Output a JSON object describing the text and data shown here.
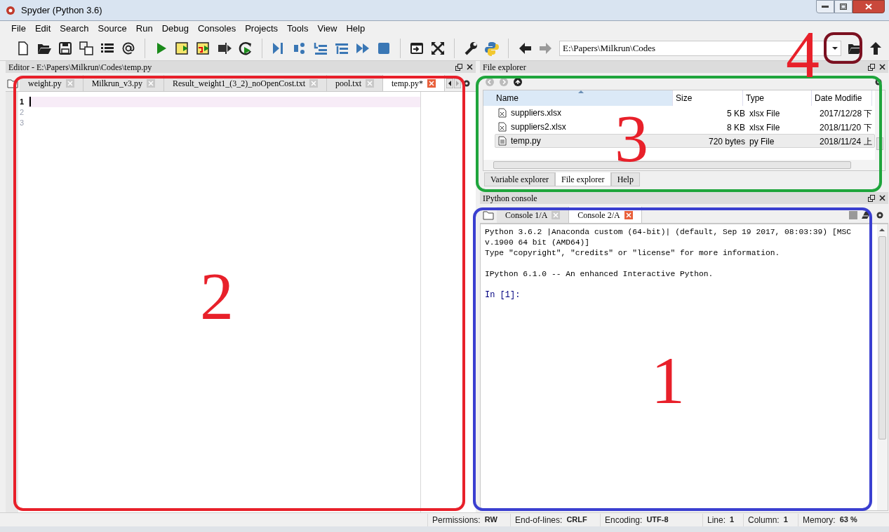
{
  "window": {
    "title": "Spyder (Python 3.6)"
  },
  "menu": [
    "File",
    "Edit",
    "Search",
    "Source",
    "Run",
    "Debug",
    "Consoles",
    "Projects",
    "Tools",
    "View",
    "Help"
  ],
  "toolbar": {
    "path": "E:\\Papers\\Milkrun\\Codes"
  },
  "editor": {
    "title": "Editor - E:\\Papers\\Milkrun\\Codes\\temp.py",
    "tabs": [
      {
        "label": "weight.py",
        "selected": false
      },
      {
        "label": "Milkrun_v3.py",
        "selected": false
      },
      {
        "label": "Result_weight1_(3_2)_noOpenCost.txt",
        "selected": false
      },
      {
        "label": "pool.txt",
        "selected": false
      },
      {
        "label": "temp.py*",
        "selected": true
      }
    ],
    "lines": [
      {
        "number": "1",
        "current": true
      },
      {
        "number": "2",
        "current": false
      },
      {
        "number": "3",
        "current": false
      }
    ]
  },
  "file_explorer": {
    "title": "File explorer",
    "columns": [
      "Name",
      "Size",
      "Type",
      "Date Modifie"
    ],
    "rows": [
      {
        "kind": "excel",
        "name": "suppliers.xlsx",
        "size": "5 KB",
        "type": "xlsx File",
        "date": "2017/12/28 下",
        "selected": false
      },
      {
        "kind": "excel",
        "name": "suppliers2.xlsx",
        "size": "8 KB",
        "type": "xlsx File",
        "date": "2018/11/20 下",
        "selected": false
      },
      {
        "kind": "text",
        "name": "temp.py",
        "size": "720 bytes",
        "type": "py File",
        "date": "2018/11/24 上",
        "selected": true
      }
    ],
    "tabs": [
      {
        "label": "Variable explorer",
        "selected": false
      },
      {
        "label": "File explorer",
        "selected": true
      },
      {
        "label": "Help",
        "selected": false
      }
    ]
  },
  "console": {
    "title": "IPython console",
    "tabs": [
      {
        "label": "Console 1/A",
        "selected": false
      },
      {
        "label": "Console 2/A",
        "selected": true
      }
    ],
    "lines": [
      {
        "kind": "output",
        "text": "Python 3.6.2 |Anaconda custom (64-bit)| (default, Sep 19 2017, 08:03:39) [MSC"
      },
      {
        "kind": "output",
        "text": "v.1900 64 bit (AMD64)]"
      },
      {
        "kind": "output",
        "text": "Type \"copyright\", \"credits\" or \"license\" for more information."
      },
      {
        "kind": "blank"
      },
      {
        "kind": "output",
        "text": "IPython 6.1.0 -- An enhanced Interactive Python."
      },
      {
        "kind": "blank"
      },
      {
        "kind": "prompt",
        "text": "In [1]:"
      }
    ]
  },
  "status_bar": [
    {
      "label": "Permissions:",
      "value": "RW"
    },
    {
      "label": "End-of-lines:",
      "value": "CRLF"
    },
    {
      "label": "Encoding:",
      "value": "UTF-8"
    },
    {
      "label": "Line:",
      "value": "1"
    },
    {
      "label": "Column:",
      "value": "1"
    },
    {
      "label": "Memory:",
      "value": "63 %"
    }
  ],
  "annotations": [
    {
      "label": "2",
      "color": "#e8202a"
    },
    {
      "label": "3",
      "color": "#e8202a"
    },
    {
      "label": "1",
      "color": "#e8202a"
    },
    {
      "label": "4",
      "color": "#e8202a"
    }
  ],
  "annotation_boxes": [
    {
      "color": "#e8202a"
    },
    {
      "color": "#1fa53c"
    },
    {
      "color": "#3a3fd0"
    },
    {
      "color": "#7b1020"
    }
  ]
}
